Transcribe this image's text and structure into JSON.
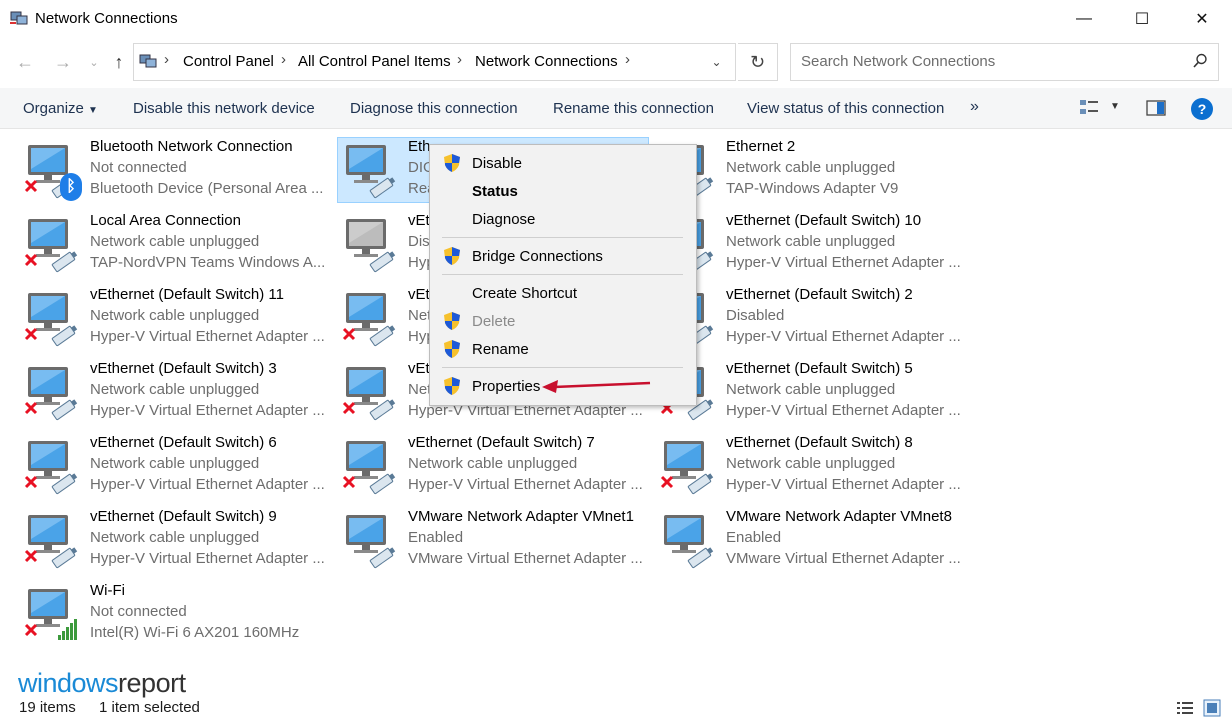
{
  "window": {
    "title": "Network Connections",
    "minimize": "—",
    "maximize": "☐",
    "close": "✕"
  },
  "nav": {
    "breadcrumbs": [
      "Control Panel",
      "All Control Panel Items",
      "Network Connections"
    ],
    "search_placeholder": "Search Network Connections"
  },
  "toolbar": {
    "organize": "Organize",
    "disable": "Disable this network device",
    "diagnose": "Diagnose this connection",
    "rename": "Rename this connection",
    "view_status": "View status of this connection",
    "more": "»"
  },
  "items": [
    {
      "name": "Bluetooth Network Connection",
      "status": "Not connected",
      "device": "Bluetooth Device (Personal Area ...",
      "error": true
    },
    {
      "name": "Eth",
      "status": "DIG",
      "device": "Rea",
      "error": false
    },
    {
      "name": "Ethernet 2",
      "status": "Network cable unplugged",
      "device": "TAP-Windows Adapter V9",
      "error": true
    },
    {
      "name": "Local Area Connection",
      "status": "Network cable unplugged",
      "device": "TAP-NordVPN Teams Windows A...",
      "error": true
    },
    {
      "name": "vEt",
      "status": "Dis",
      "device": "Hyp",
      "error": false
    },
    {
      "name": "vEthernet (Default Switch) 10",
      "status": "Network cable unplugged",
      "device": "Hyper-V Virtual Ethernet Adapter ...",
      "error": true
    },
    {
      "name": "vEthernet (Default Switch) 11",
      "status": "Network cable unplugged",
      "device": "Hyper-V Virtual Ethernet Adapter ...",
      "error": true
    },
    {
      "name": "vEt",
      "status": "Net",
      "device": "Hyp",
      "error": true
    },
    {
      "name": "vEthernet (Default Switch) 2",
      "status": "Disabled",
      "device": "Hyper-V Virtual Ethernet Adapter ...",
      "error": true
    },
    {
      "name": "vEthernet (Default Switch) 3",
      "status": "Network cable unplugged",
      "device": "Hyper-V Virtual Ethernet Adapter ...",
      "error": true
    },
    {
      "name": "vEt",
      "status": "Net",
      "device": "Hyper-V Virtual Ethernet Adapter ...",
      "error": true
    },
    {
      "name": "vEthernet (Default Switch) 5",
      "status": "Network cable unplugged",
      "device": "Hyper-V Virtual Ethernet Adapter ...",
      "error": true
    },
    {
      "name": "vEthernet (Default Switch) 6",
      "status": "Network cable unplugged",
      "device": "Hyper-V Virtual Ethernet Adapter ...",
      "error": true
    },
    {
      "name": "vEthernet (Default Switch) 7",
      "status": "Network cable unplugged",
      "device": "Hyper-V Virtual Ethernet Adapter ...",
      "error": true
    },
    {
      "name": "vEthernet (Default Switch) 8",
      "status": "Network cable unplugged",
      "device": "Hyper-V Virtual Ethernet Adapter ...",
      "error": true
    },
    {
      "name": "vEthernet (Default Switch) 9",
      "status": "Network cable unplugged",
      "device": "Hyper-V Virtual Ethernet Adapter ...",
      "error": true
    },
    {
      "name": "VMware Network Adapter VMnet1",
      "status": "Enabled",
      "device": "VMware Virtual Ethernet Adapter ...",
      "error": false
    },
    {
      "name": "VMware Network Adapter VMnet8",
      "status": "Enabled",
      "device": "VMware Virtual Ethernet Adapter ...",
      "error": false
    },
    {
      "name": "Wi-Fi",
      "status": "Not connected",
      "device": "Intel(R) Wi-Fi 6 AX201 160MHz",
      "error": true
    }
  ],
  "context_menu": {
    "disable": "Disable",
    "status": "Status",
    "diagnose": "Diagnose",
    "bridge": "Bridge Connections",
    "shortcut": "Create Shortcut",
    "delete": "Delete",
    "rename": "Rename",
    "properties": "Properties"
  },
  "statusbar": {
    "count": "19 items",
    "selected": "1 item selected"
  },
  "watermark": {
    "part1": "windows",
    "part2": "report"
  },
  "colors": {
    "selection": "#cce8ff",
    "accent": "#0b6fd0",
    "arrow": "#c8102e"
  }
}
